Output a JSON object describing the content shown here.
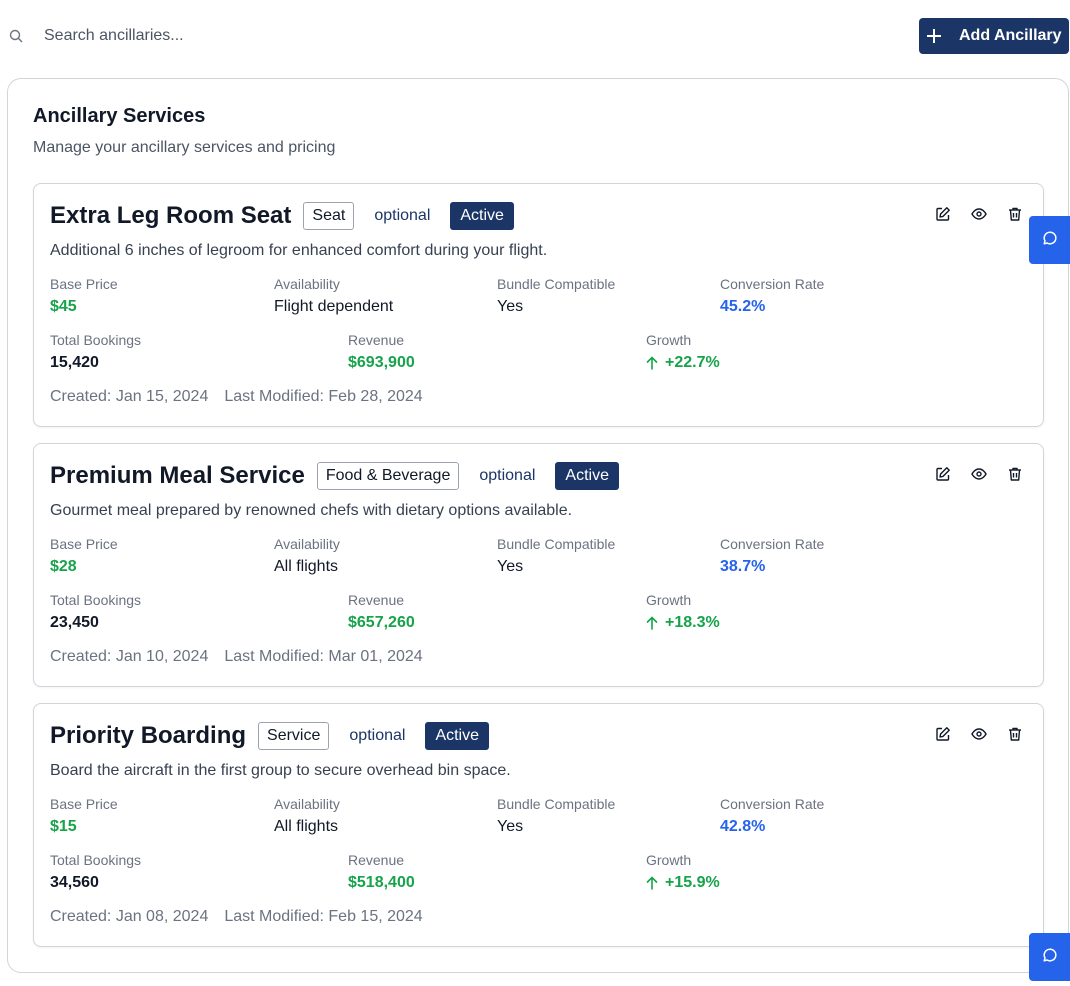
{
  "search": {
    "placeholder": "Search ancillaries..."
  },
  "toolbar": {
    "add_label": "Add Ancillary"
  },
  "panel": {
    "title": "Ancillary Services",
    "subtitle": "Manage your ancillary services and pricing"
  },
  "labels": {
    "base_price": "Base Price",
    "availability": "Availability",
    "bundle": "Bundle Compatible",
    "conversion": "Conversion Rate",
    "bookings": "Total Bookings",
    "revenue": "Revenue",
    "growth": "Growth"
  },
  "colors": {
    "brand": "#1a3566",
    "accent": "#2563eb",
    "positive": "#16a34a"
  },
  "cards": [
    {
      "name": "Extra Leg Room Seat",
      "category": "Seat",
      "type": "optional",
      "status": "Active",
      "description": "Additional 6 inches of legroom for enhanced comfort during your flight.",
      "base_price": "$45",
      "availability": "Flight dependent",
      "bundle": "Yes",
      "conversion": "45.2%",
      "bookings": "15,420",
      "revenue": "$693,900",
      "growth": "+22.7%",
      "created": "Created: Jan 15, 2024",
      "modified": "Last Modified: Feb 28, 2024"
    },
    {
      "name": "Premium Meal Service",
      "category": "Food & Beverage",
      "type": "optional",
      "status": "Active",
      "description": "Gourmet meal prepared by renowned chefs with dietary options available.",
      "base_price": "$28",
      "availability": "All flights",
      "bundle": "Yes",
      "conversion": "38.7%",
      "bookings": "23,450",
      "revenue": "$657,260",
      "growth": "+18.3%",
      "created": "Created: Jan 10, 2024",
      "modified": "Last Modified: Mar 01, 2024"
    },
    {
      "name": "Priority Boarding",
      "category": "Service",
      "type": "optional",
      "status": "Active",
      "description": "Board the aircraft in the first group to secure overhead bin space.",
      "base_price": "$15",
      "availability": "All flights",
      "bundle": "Yes",
      "conversion": "42.8%",
      "bookings": "34,560",
      "revenue": "$518,400",
      "growth": "+15.9%",
      "created": "Created: Jan 08, 2024",
      "modified": "Last Modified: Feb 15, 2024"
    }
  ]
}
